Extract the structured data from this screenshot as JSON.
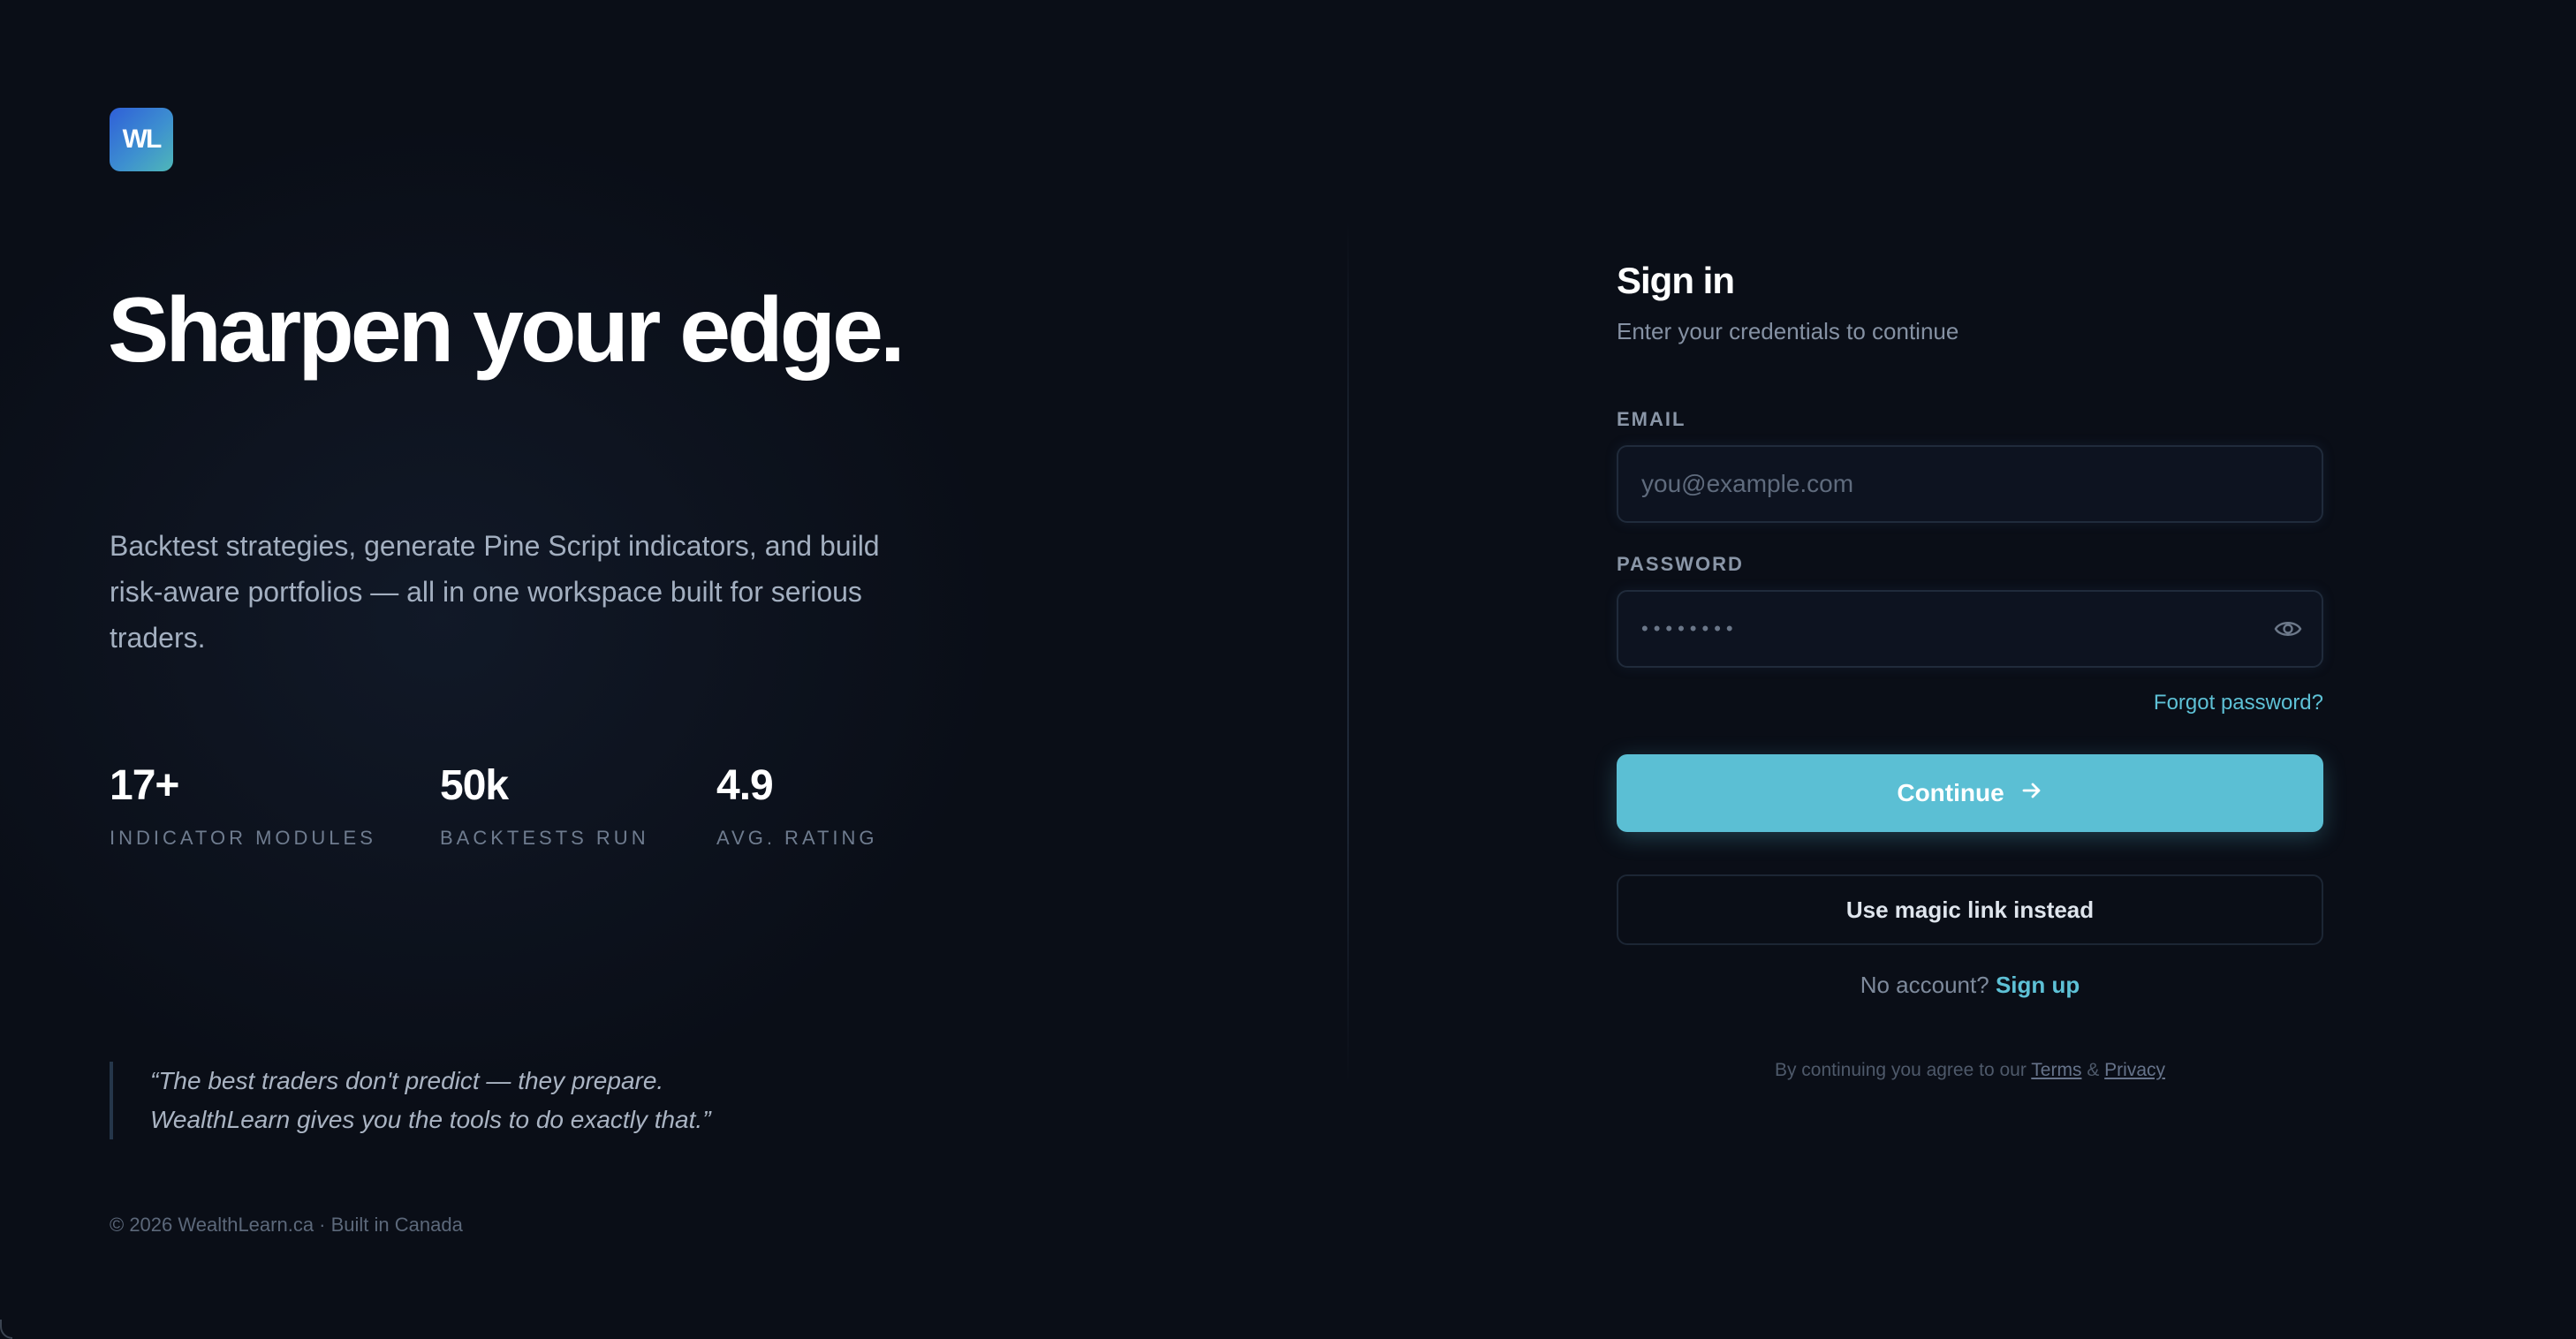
{
  "brand": {
    "logo_text": "WL"
  },
  "hero": {
    "headline": "Sharpen your edge.",
    "subcopy": "Backtest strategies, generate Pine Script indicators, and build risk-aware portfolios — all in one workspace built for serious traders."
  },
  "stats": [
    {
      "value": "17+",
      "label": "INDICATOR MODULES"
    },
    {
      "value": "50k",
      "label": "BACKTESTS RUN"
    },
    {
      "value": "4.9",
      "label": "AVG. RATING"
    }
  ],
  "quote": {
    "line1": "“The best traders don't predict — they prepare.",
    "line2": "WealthLearn gives you the tools to do exactly that.”"
  },
  "footer": {
    "note": "© 2026 WealthLearn.ca · Built in Canada"
  },
  "form": {
    "title": "Sign in",
    "subtitle": "Enter your credentials to continue",
    "email_label": "EMAIL",
    "email_placeholder": "you@example.com",
    "email_value": "",
    "password_label": "PASSWORD",
    "password_placeholder": "••••••••",
    "password_value": "",
    "forgot_label": "Forgot password?",
    "continue_label": "Continue",
    "magic_link_label": "Use magic link instead",
    "no_account_text": "No account?",
    "signup_label": "Sign up",
    "legal_prefix": "By continuing you agree to our",
    "terms_label": "Terms",
    "amp": "&",
    "privacy_label": "Privacy"
  },
  "colors": {
    "background": "#0a0e17",
    "accent": "#5bbfd4",
    "link": "#5ec1d6",
    "logo_gradient_start": "#2f5fd8",
    "logo_gradient_end": "#4fb7b8"
  },
  "icons": {
    "password_toggle": "eye-icon",
    "continue_arrow": "arrow-right-icon"
  }
}
